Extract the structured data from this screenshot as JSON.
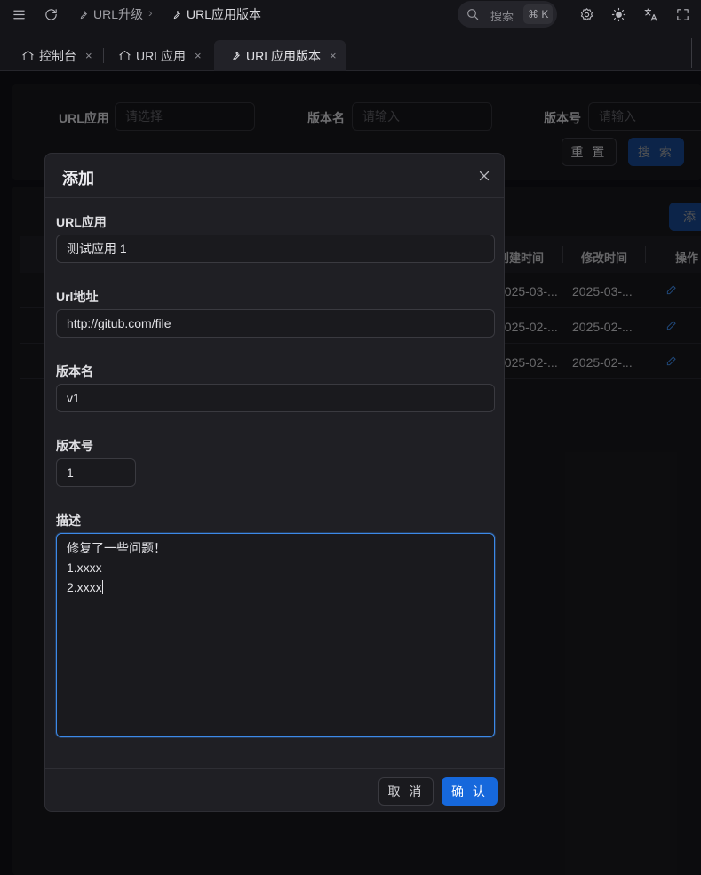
{
  "header": {
    "breadcrumb": [
      {
        "label": "URL升级",
        "icon": "wrench-icon"
      },
      {
        "label": "URL应用版本",
        "icon": "wrench-icon"
      }
    ],
    "search_placeholder": "搜索",
    "search_shortcut": "⌘ K"
  },
  "tabs": [
    {
      "label": "控制台",
      "icon": "home-icon",
      "close": "×"
    },
    {
      "label": "URL应用",
      "icon": "home-icon",
      "close": "×"
    },
    {
      "label": "URL应用版本",
      "icon": "wrench-icon",
      "close": "×",
      "active": true
    }
  ],
  "filters": {
    "app_label": "URL应用",
    "app_placeholder": "请选择",
    "version_name_label": "版本名",
    "version_name_placeholder": "请输入",
    "version_no_label": "版本号",
    "version_no_placeholder": "请输入",
    "reset_label": "重 置",
    "search_label": "搜 索"
  },
  "toolbar": {
    "add_label": "添 加"
  },
  "table": {
    "columns": [
      "创建时间",
      "修改时间",
      "操作"
    ],
    "rows": [
      {
        "created": "2025-03-...",
        "modified": "2025-03-..."
      },
      {
        "created": "2025-02-...",
        "modified": "2025-02-..."
      },
      {
        "created": "2025-02-...",
        "modified": "2025-02-..."
      }
    ]
  },
  "modal": {
    "title": "添加",
    "fields": {
      "app_label": "URL应用",
      "app_value": "测试应用 1",
      "url_label": "Url地址",
      "url_value": "http://gitub.com/file",
      "version_name_label": "版本名",
      "version_name_value": "v1",
      "version_no_label": "版本号",
      "version_no_value": "1",
      "desc_label": "描述",
      "desc_lines": [
        "修复了一些问题！",
        "1.xxxx",
        "2.xxxx"
      ]
    },
    "cancel_label": "取 消",
    "confirm_label": "确 认"
  },
  "colors": {
    "accent": "#1668dc",
    "focus": "#3c89e8"
  }
}
